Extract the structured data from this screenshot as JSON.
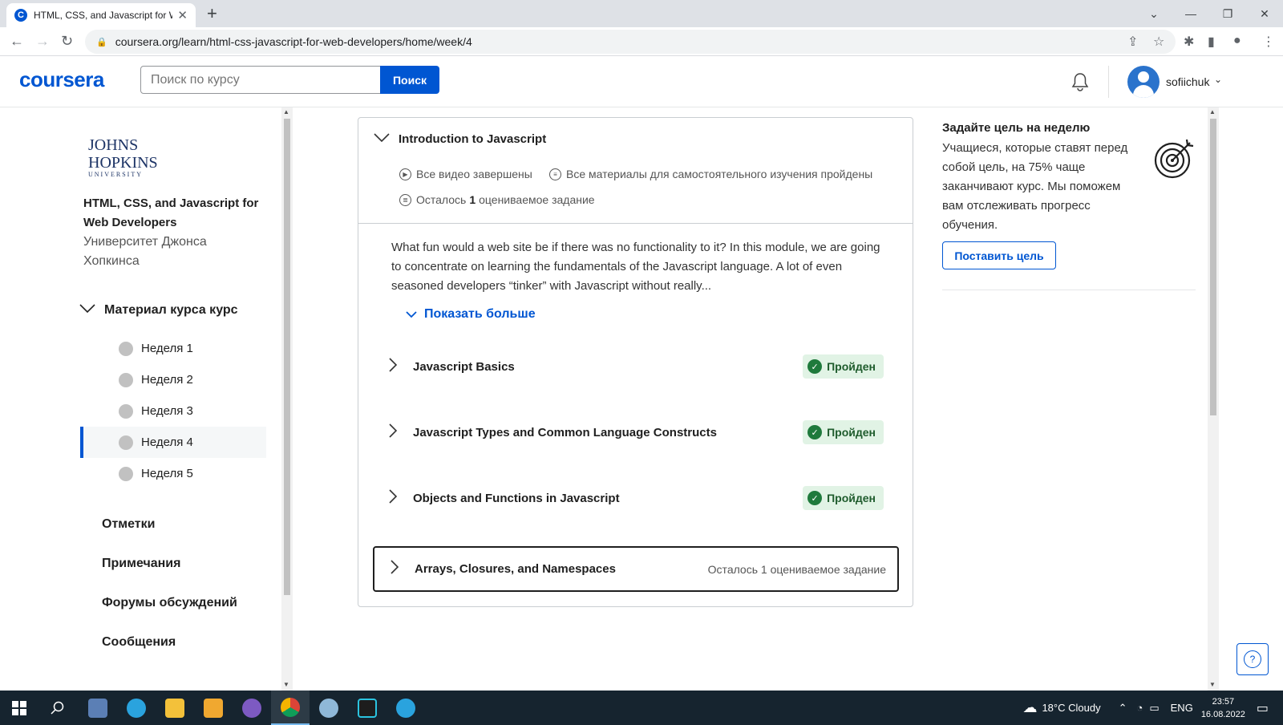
{
  "browser": {
    "tab_title": "HTML, CSS, and Javascript for We",
    "url": "coursera.org/learn/html-css-javascript-for-web-developers/home/week/4"
  },
  "header": {
    "logo": "coursera",
    "search_placeholder": "Поиск по курсу",
    "search_button": "Поиск",
    "username": "sofiichuk"
  },
  "sidebar": {
    "university_logo": {
      "line1": "JOHNS",
      "line2": "HOPKINS",
      "line3": "UNIVERSITY"
    },
    "course_title": "HTML, CSS, and Javascript for Web Developers",
    "partner": "Университет Джонса Хопкинса",
    "material_heading": "Материал курса курс",
    "weeks": [
      {
        "label": "Неделя 1"
      },
      {
        "label": "Неделя 2"
      },
      {
        "label": "Неделя 3"
      },
      {
        "label": "Неделя 4"
      },
      {
        "label": "Неделя 5"
      }
    ],
    "links": [
      "Отметки",
      "Примечания",
      "Форумы обсуждений",
      "Сообщения"
    ]
  },
  "module": {
    "title": "Introduction to Javascript",
    "stats": {
      "videos": "Все видео завершены",
      "readings": "Все материалы для самостоятельного изучения пройдены",
      "graded_prefix": "Осталось",
      "graded_count": "1",
      "graded_suffix": "оцениваемое задание"
    },
    "description": "What fun would a web site be if there was no functionality to it? In this module, we are going to concentrate on learning the fundamentals of the Javascript language. A lot of even seasoned developers “tinker” with Javascript without really...",
    "show_more": "Показать больше",
    "lessons": [
      {
        "title": "Javascript Basics",
        "status": "Пройден"
      },
      {
        "title": "Javascript Types and Common Language Constructs",
        "status": "Пройден"
      },
      {
        "title": "Objects and Functions in Javascript",
        "status": "Пройден"
      },
      {
        "title": "Arrays, Closures, and Namespaces",
        "remaining": "Осталось 1 оцениваемое задание"
      }
    ]
  },
  "goal": {
    "title": "Задайте цель на неделю",
    "text": "Учащиеся, которые ставят перед собой цель, на 75% чаще заканчивают курс. Мы поможем вам отслеживать прогресс обучения.",
    "button": "Поставить цель"
  },
  "taskbar": {
    "weather": "18°C  Cloudy",
    "lang": "ENG",
    "time": "23:57",
    "date": "16.08.2022"
  },
  "colors": {
    "brand": "#0056d2",
    "success_bg": "#e1f3e5",
    "success": "#1f7a3c"
  }
}
